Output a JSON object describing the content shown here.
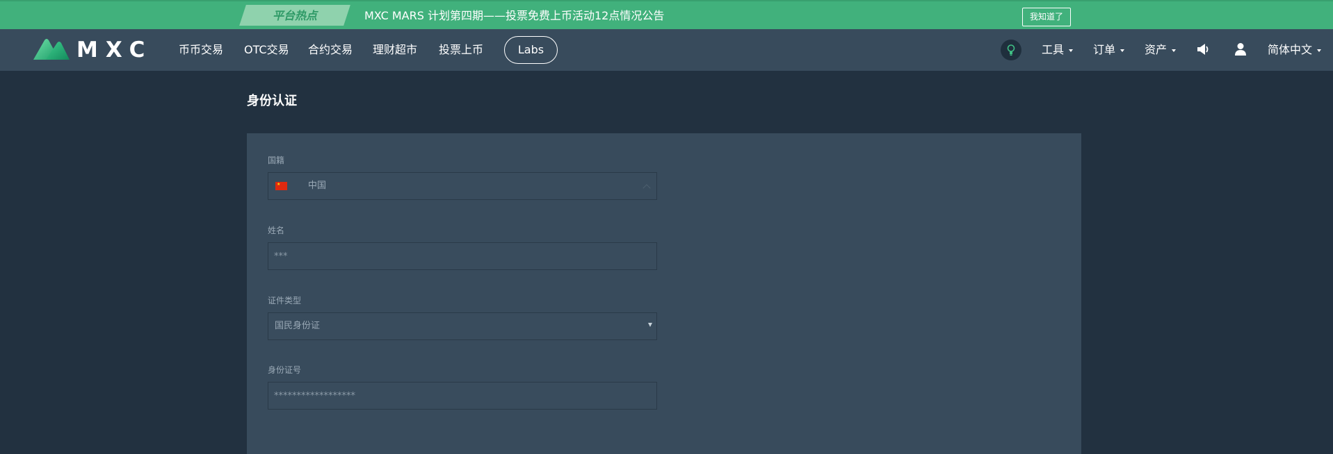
{
  "announcement": {
    "tag": "平台热点",
    "text": "MXC MARS 计划第四期——投票免费上币活动12点情况公告",
    "dismiss_label": "我知道了"
  },
  "header": {
    "brand": "MXC",
    "nav": [
      {
        "label": "币币交易"
      },
      {
        "label": "OTC交易"
      },
      {
        "label": "合约交易"
      },
      {
        "label": "理财超市"
      },
      {
        "label": "投票上币"
      }
    ],
    "labs_label": "Labs",
    "right_menu": {
      "tools": "工具",
      "orders": "订单",
      "assets": "资产",
      "language": "简体中文"
    }
  },
  "page": {
    "title": "身份认证",
    "form": {
      "nationality": {
        "label": "国籍",
        "value": "中国"
      },
      "name": {
        "label": "姓名",
        "placeholder": "***"
      },
      "id_type": {
        "label": "证件类型",
        "value": "国民身份证"
      },
      "id_number": {
        "label": "身份证号",
        "placeholder": "******************"
      }
    }
  },
  "colors": {
    "announce_bg": "#41b17c",
    "nav_bg": "#384b5c",
    "page_bg": "#223140",
    "panel_bg": "#384b5c",
    "label": "#9aa9b6"
  },
  "icons": {
    "theme": "lightbulb-icon",
    "announcements": "megaphone-icon",
    "account": "user-icon",
    "flag": "china-flag-icon"
  }
}
